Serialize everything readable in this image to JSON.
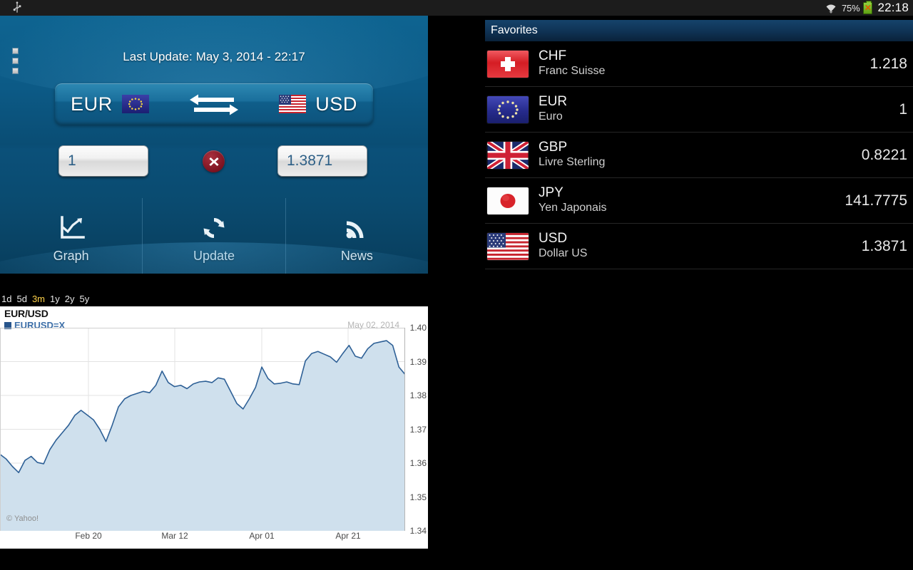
{
  "statusbar": {
    "usb_icon": "usb-icon",
    "wifi_icon": "wifi-icon",
    "battery_percent": "75%",
    "battery_icon": "battery-charging-icon",
    "clock": "22:18"
  },
  "converter": {
    "menu_icon": "overflow-menu-icon",
    "last_update": "Last Update: May 3, 2014 - 22:17",
    "from_currency": "EUR",
    "from_flag": "flag-eur-icon",
    "swap_icon": "swap-arrows-icon",
    "to_currency": "USD",
    "to_flag": "flag-usd-icon",
    "amount_from": "1",
    "amount_to": "1.3871",
    "clear_icon": "clear-x-icon",
    "actions": [
      {
        "label": "Graph",
        "icon": "line-chart-icon"
      },
      {
        "label": "Update",
        "icon": "refresh-icon"
      },
      {
        "label": "News",
        "icon": "rss-icon"
      }
    ]
  },
  "chart_ranges": {
    "items": [
      "1d",
      "5d",
      "3m",
      "1y",
      "2y",
      "5y"
    ],
    "active": "3m"
  },
  "favorites": {
    "header": "Favorites",
    "rows": [
      {
        "code": "CHF",
        "name": "Franc Suisse",
        "rate": "1.218",
        "flag": "flag-chf-icon"
      },
      {
        "code": "EUR",
        "name": "Euro",
        "rate": "1",
        "flag": "flag-eur-icon"
      },
      {
        "code": "GBP",
        "name": "Livre Sterling",
        "rate": "0.8221",
        "flag": "flag-gbp-icon"
      },
      {
        "code": "JPY",
        "name": "Yen Japonais",
        "rate": "141.7775",
        "flag": "flag-jpy-icon"
      },
      {
        "code": "USD",
        "name": "Dollar US",
        "rate": "1.3871",
        "flag": "flag-usd-icon"
      }
    ]
  },
  "chart_data": {
    "type": "area",
    "title": "EUR/USD",
    "series_label": "EURUSD=X",
    "date_label": "May 02, 2014",
    "watermark": "© Yahoo!",
    "xlabel": "",
    "ylabel": "",
    "ylim": [
      1.34,
      1.4
    ],
    "grid": true,
    "legend": "top-left",
    "line_color": "#2e6096",
    "fill_color": "#cfe0ed",
    "yticks": [
      "1.40",
      "1.39",
      "1.38",
      "1.37",
      "1.36",
      "1.35",
      "1.34"
    ],
    "ytick_values": [
      1.4,
      1.39,
      1.38,
      1.37,
      1.36,
      1.35,
      1.34
    ],
    "xticks": [
      "Feb 20",
      "Mar 12",
      "Apr 01",
      "Apr 21"
    ],
    "xtick_positions": [
      124,
      245,
      367,
      488
    ],
    "values": [
      1.3626,
      1.3612,
      1.359,
      1.3572,
      1.3608,
      1.362,
      1.3602,
      1.3598,
      1.364,
      1.3668,
      1.369,
      1.3712,
      1.3741,
      1.3756,
      1.3742,
      1.3728,
      1.37,
      1.3664,
      1.3712,
      1.3766,
      1.379,
      1.38,
      1.3806,
      1.3812,
      1.3808,
      1.383,
      1.3872,
      1.3838,
      1.3826,
      1.383,
      1.382,
      1.3834,
      1.384,
      1.3842,
      1.3838,
      1.3852,
      1.3848,
      1.3812,
      1.3776,
      1.376,
      1.379,
      1.3824,
      1.3884,
      1.385,
      1.3834,
      1.3836,
      1.384,
      1.3834,
      1.3832,
      1.3902,
      1.3924,
      1.393,
      1.3922,
      1.3914,
      1.3898,
      1.3924,
      1.3948,
      1.3916,
      1.391,
      1.3938,
      1.3954,
      1.3958,
      1.3962,
      1.3948,
      1.3884,
      1.3862
    ]
  }
}
